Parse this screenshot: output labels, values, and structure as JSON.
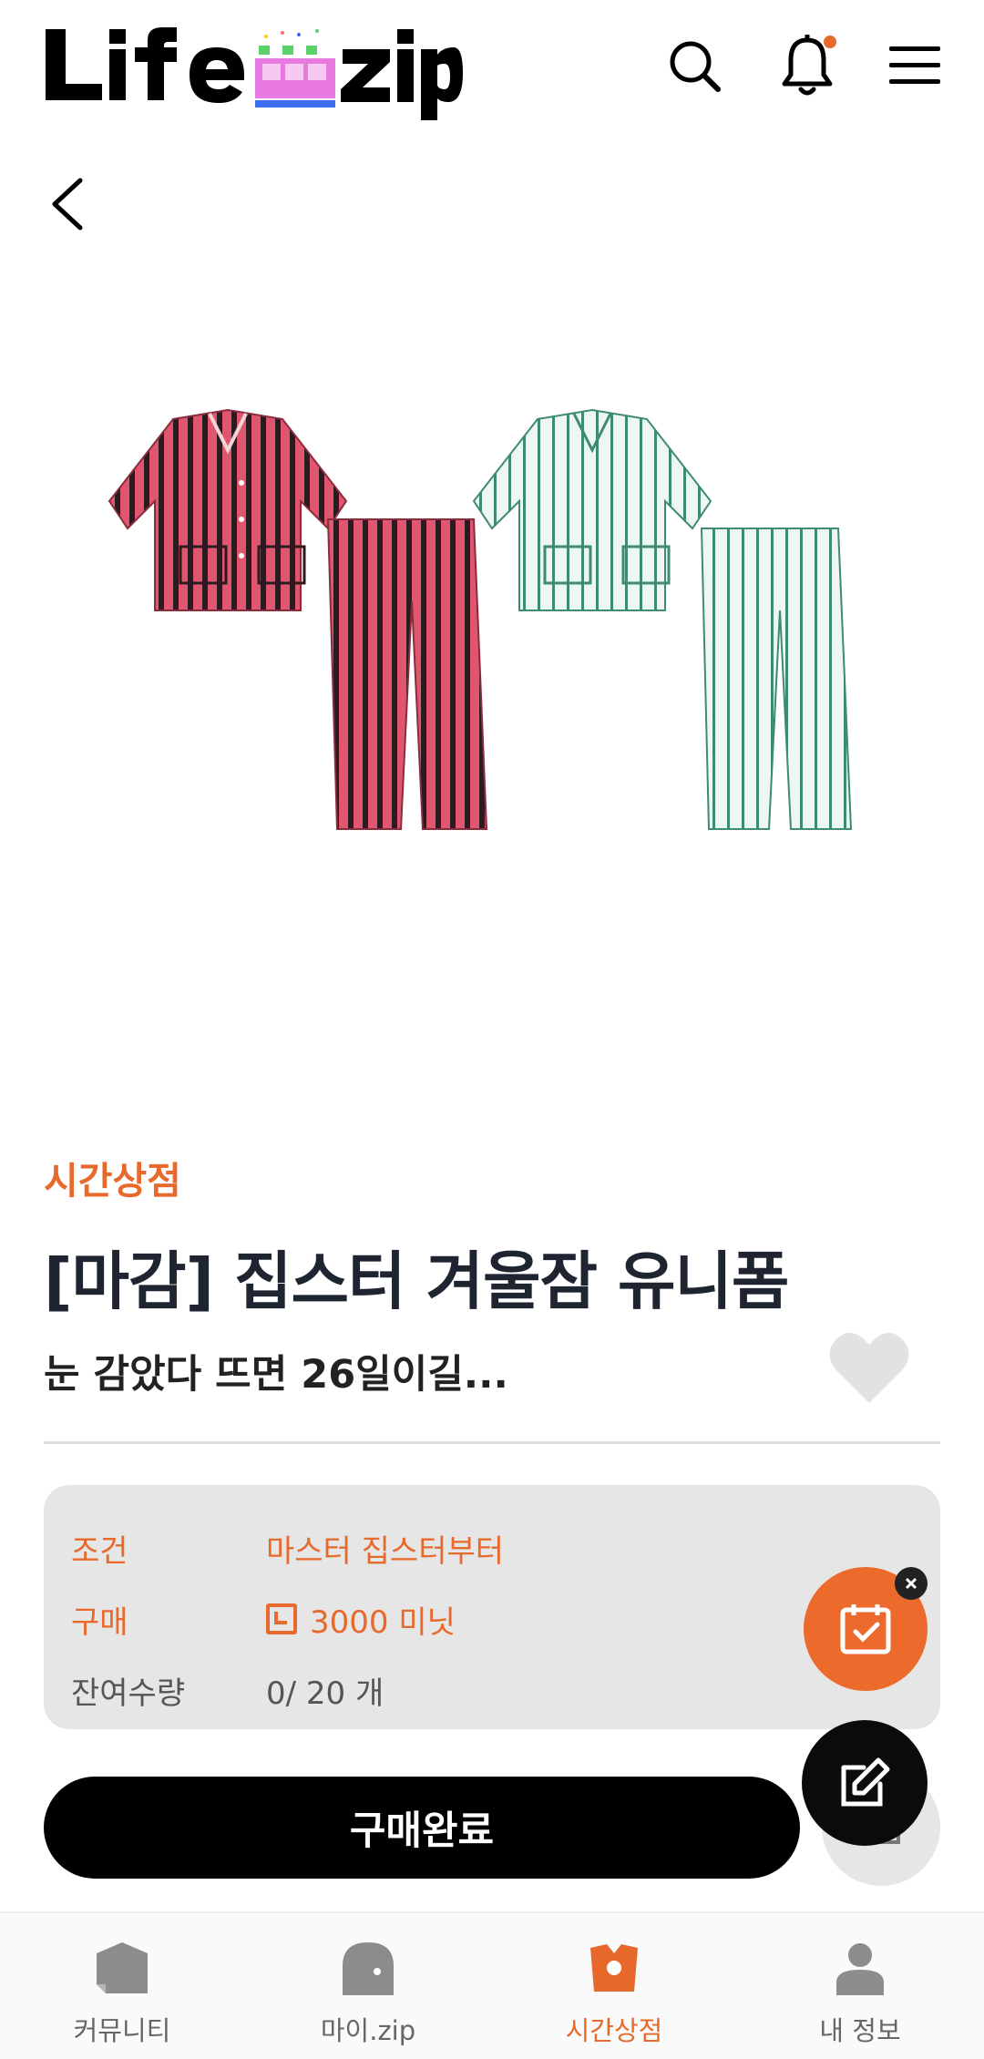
{
  "header": {
    "logo_text": "Life zip",
    "search_icon": "search-icon",
    "bell_icon": "bell-icon",
    "menu_icon": "hamburger-menu-icon",
    "accent": "#E8692C"
  },
  "product": {
    "category": "시간상점",
    "title": "[마감] 집스터 겨울잠 유니폼",
    "subtitle": "눈 감았다 뜨면 26일이길...",
    "image_alt": "pink and mint striped pajama sets"
  },
  "info": {
    "condition_label": "조건",
    "condition_value": "마스터 집스터부터",
    "price_label": "구매",
    "price_value": "3000 미닛",
    "stock_label": "잔여수량",
    "stock_value": "0/ 20 개"
  },
  "actions": {
    "buy_label": "구매완료"
  },
  "bottom_nav": {
    "items": [
      {
        "label": "커뮤니티",
        "icon": "community-icon"
      },
      {
        "label": "마이.zip",
        "icon": "myzip-icon"
      },
      {
        "label": "시간상점",
        "icon": "time-shop-icon"
      },
      {
        "label": "내 정보",
        "icon": "profile-icon"
      }
    ],
    "active_index": 2
  },
  "colors": {
    "orange": "#E8692C",
    "dark": "#1e2430",
    "box": "#e6e6e6"
  }
}
